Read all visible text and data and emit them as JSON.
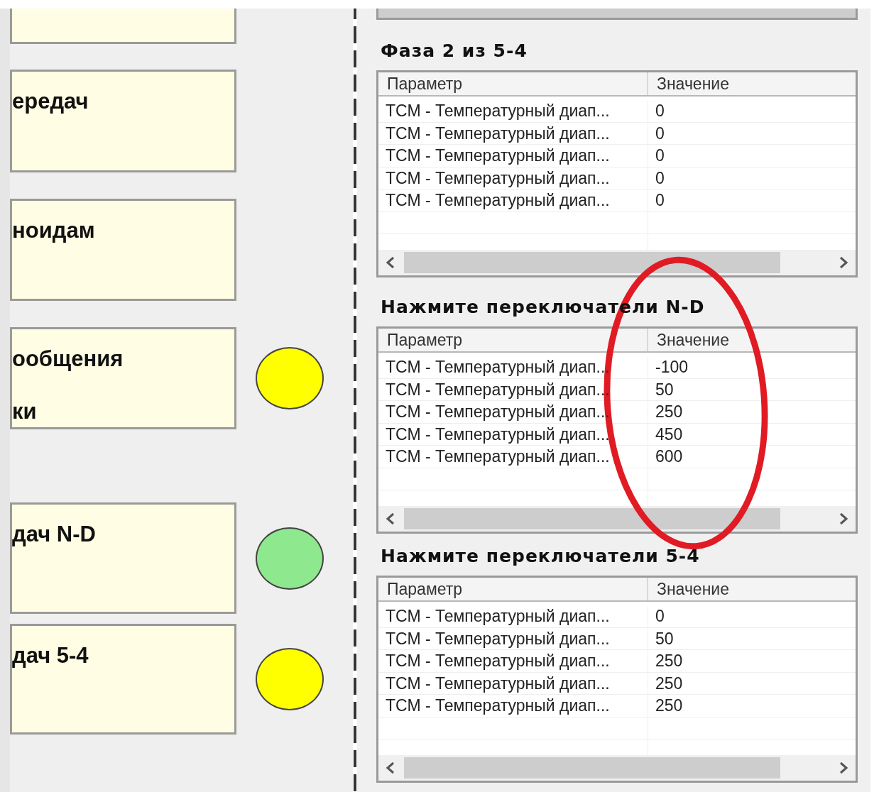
{
  "left_panel": {
    "cards": [
      {
        "kind": "cut"
      },
      {
        "kind": "full",
        "lines": [
          "ередач"
        ]
      },
      {
        "kind": "full",
        "lines": [
          "ноидам"
        ]
      },
      {
        "kind": "full",
        "lines": [
          "ообщения",
          "ки"
        ],
        "color": "#ffff00"
      },
      {
        "kind": "full",
        "lines": [
          "дач N-D"
        ],
        "color": "#8ee88e"
      },
      {
        "kind": "full",
        "lines": [
          "дач 5-4"
        ],
        "color": "#ffff00"
      }
    ]
  },
  "sections": [
    {
      "title": "Фаза 2 из 5-4",
      "columns": [
        "Параметр",
        "Значение"
      ],
      "rows": [
        [
          "ТСМ - Температурный диап...",
          "0"
        ],
        [
          "ТСМ - Температурный диап...",
          "0"
        ],
        [
          "ТСМ - Температурный диап...",
          "0"
        ],
        [
          "ТСМ - Температурный диап...",
          "0"
        ],
        [
          "ТСМ - Температурный диап...",
          "0"
        ]
      ]
    },
    {
      "title": "Нажмите переключатели N-D",
      "columns": [
        "Параметр",
        "Значение"
      ],
      "rows": [
        [
          "ТСМ - Температурный диап...",
          "-100"
        ],
        [
          "ТСМ - Температурный диап...",
          "50"
        ],
        [
          "ТСМ - Температурный диап...",
          "250"
        ],
        [
          "ТСМ - Температурный диап...",
          "450"
        ],
        [
          "ТСМ - Температурный диап...",
          "600"
        ]
      ]
    },
    {
      "title": "Нажмите переключатели 5-4",
      "columns": [
        "Параметр",
        "Значение"
      ],
      "rows": [
        [
          "ТСМ - Температурный диап...",
          "0"
        ],
        [
          "ТСМ - Температурный диап...",
          "50"
        ],
        [
          "ТСМ - Температурный диап...",
          "250"
        ],
        [
          "ТСМ - Температурный диап...",
          "250"
        ],
        [
          "ТСМ - Температурный диап...",
          "250"
        ]
      ]
    }
  ],
  "annotation": {
    "kind": "ellipse"
  }
}
